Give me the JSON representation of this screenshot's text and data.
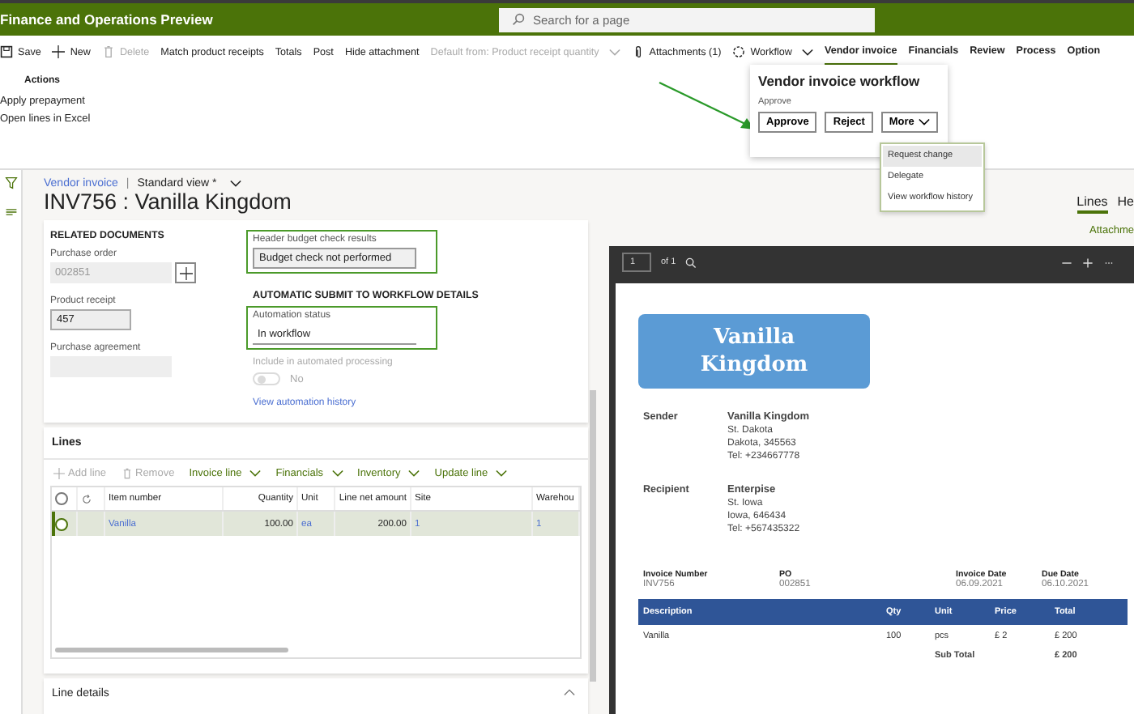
{
  "app_bar": {
    "title": "Finance and Operations Preview",
    "search": {
      "placeholder": "Search for a page"
    }
  },
  "action_bar": {
    "items": [
      {
        "label": "Save",
        "kind": "save",
        "disabled": false
      },
      {
        "label": "New",
        "kind": "new",
        "disabled": false
      },
      {
        "label": "Delete",
        "kind": "delete",
        "disabled": true
      },
      {
        "label": "Match product receipts",
        "kind": "plain",
        "disabled": false
      },
      {
        "label": "Totals",
        "kind": "plain",
        "disabled": false
      },
      {
        "label": "Post",
        "kind": "plain",
        "disabled": false
      },
      {
        "label": "Hide attachment",
        "kind": "plain",
        "disabled": false
      },
      {
        "label": "Default from: Product receipt quantity",
        "kind": "dropdown",
        "disabled": true
      },
      {
        "label": "Attachments (1)",
        "kind": "attach",
        "disabled": false
      },
      {
        "label": "Workflow",
        "kind": "workflow",
        "disabled": false
      }
    ],
    "tabs": [
      {
        "label": "Vendor invoice",
        "selected": true
      },
      {
        "label": "Financials",
        "selected": false
      },
      {
        "label": "Review",
        "selected": false
      },
      {
        "label": "Process",
        "selected": false
      },
      {
        "label": "Option",
        "selected": false
      }
    ]
  },
  "action_group": {
    "heading": "Actions",
    "items": [
      "Apply prepayment",
      "Open lines in Excel"
    ]
  },
  "workflow_popup": {
    "title": "Vendor invoice workflow",
    "section": "Approve",
    "buttons": [
      {
        "label": "Approve",
        "kind": "approve"
      },
      {
        "label": "Reject",
        "kind": "reject"
      },
      {
        "label": "More",
        "kind": "dropdown"
      }
    ],
    "menu": [
      {
        "label": "Request change",
        "selected": true
      },
      {
        "label": "Delegate",
        "selected": false
      },
      {
        "label": "View workflow history",
        "selected": false
      }
    ]
  },
  "page": {
    "breadcrumb": {
      "link": "Vendor invoice",
      "separator": "|",
      "view": "Standard view *"
    },
    "title": "INV756 : Vanilla Kingdom",
    "right_tabs": [
      {
        "label": "Lines",
        "selected": true
      },
      {
        "label": "He",
        "selected": false
      }
    ],
    "attachments_link": "Attachme"
  },
  "related_documents": {
    "heading": "RELATED DOCUMENTS",
    "fields": [
      {
        "label": "Purchase order",
        "value": "002851",
        "disabled": true,
        "kind": "lookup"
      },
      {
        "label": "Product receipt",
        "value": "457",
        "disabled": false,
        "kind": "text"
      },
      {
        "label": "Purchase agreement",
        "disabled": true,
        "kind": "text"
      }
    ]
  },
  "budget_field": {
    "label": "Header budget check results",
    "value": "Budget check not performed",
    "highlighted": true
  },
  "auto_submit": {
    "heading": "AUTOMATIC SUBMIT TO WORKFLOW DETAILS",
    "status_field": {
      "label": "Automation status",
      "value": "In workflow",
      "highlighted": true
    },
    "toggle": {
      "label": "Include in automated processing",
      "on": false,
      "disabled": true,
      "state_text": "No"
    },
    "link": "View automation history"
  },
  "lines": {
    "title": "Lines",
    "all_selected": false,
    "toolbar": [
      {
        "label": "Add line",
        "kind": "add",
        "disabled": true
      },
      {
        "label": "Remove",
        "kind": "remove",
        "disabled": true
      },
      {
        "label": "Invoice line",
        "kind": "menu",
        "disabled": false
      },
      {
        "label": "Financials",
        "kind": "menu",
        "disabled": false
      },
      {
        "label": "Inventory",
        "kind": "menu",
        "disabled": false
      },
      {
        "label": "Update line",
        "kind": "menu",
        "disabled": false
      }
    ],
    "columns": [
      {
        "label": "Item number",
        "kind": "link"
      },
      {
        "label": "Quantity",
        "kind": "number"
      },
      {
        "label": "Unit",
        "kind": "link"
      },
      {
        "label": "Line net amount",
        "kind": "number"
      },
      {
        "label": "Site",
        "kind": "link"
      },
      {
        "label": "Warehou",
        "kind": "link"
      }
    ],
    "rows": [
      {
        "selected": true,
        "cells": [
          "Vanilla",
          "100.00",
          "ea",
          "200.00",
          "1",
          "1"
        ]
      }
    ]
  },
  "line_details": {
    "title": "Line details",
    "expanded": true
  },
  "viewer": {
    "page": "1",
    "page_count": "of 1",
    "document": {
      "logo": "Vanilla Kingdom",
      "parties": [
        {
          "label": "Sender",
          "name": "Vanilla Kingdom",
          "lines": [
            "St. Dakota",
            "Dakota, 345563",
            "Tel: +234667778"
          ]
        },
        {
          "label": "Recipient",
          "name": "Enterpise",
          "lines": [
            "St. Iowa",
            "Iowa, 646434",
            "Tel: +567435322"
          ]
        }
      ],
      "meta": [
        {
          "label": "Invoice Number",
          "value": "INV756"
        },
        {
          "label": "PO",
          "value": "002851"
        },
        {
          "label": "Invoice Date",
          "value": "06.09.2021"
        },
        {
          "label": "Due Date",
          "value": "06.10.2021"
        }
      ],
      "table": {
        "columns": [
          "Description",
          "Qty",
          "Unit",
          "Price",
          "Total"
        ],
        "rows": [
          [
            "Vanilla",
            "100",
            "pcs",
            "£ 2",
            "£ 200"
          ]
        ],
        "subtotal": {
          "label": "Sub Total",
          "value": "£ 200"
        }
      }
    }
  }
}
